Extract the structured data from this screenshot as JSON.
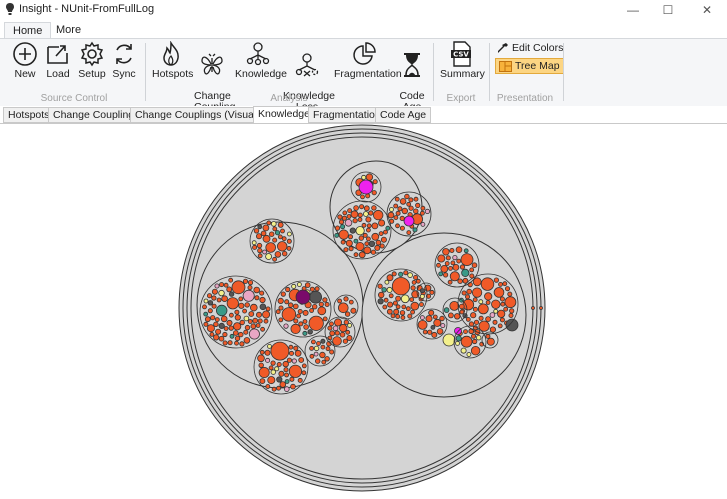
{
  "window": {
    "title": "Insight - NUnit-FromFullLog",
    "minimize": "—",
    "maximize": "☐",
    "close": "✕"
  },
  "ribbon_tabs": [
    "Home",
    "More"
  ],
  "ribbon": {
    "source_control": {
      "label": "Source Control",
      "buttons": [
        "New",
        "Load",
        "Setup",
        "Sync"
      ]
    },
    "analysis": {
      "label": "Analysis",
      "buttons": [
        "Hotspots",
        "Change\nCoupling",
        "Knowledge",
        "Knowledge\nLoss",
        "Fragmentation",
        "Code\nAge"
      ]
    },
    "export": {
      "label": "Export",
      "buttons": [
        "Summary"
      ]
    },
    "presentation": {
      "label": "Presentation",
      "edit_colors": "Edit Colors",
      "tree_map": "Tree Map"
    }
  },
  "doc_tabs": [
    "Hotspots",
    "Change Couplings",
    "Change Couplings (Visualize)",
    "Knowledge",
    "Fragmentation",
    "Code Age"
  ],
  "active_doc_tab": "Knowledge",
  "colors": {
    "orange": "#f05a28",
    "outline": "#333333",
    "container": "#d4d4d4",
    "magenta": "#ee22ee",
    "purple": "#7a0b6a",
    "teal": "#3a9a88",
    "yellow": "#f3f08c",
    "pink": "#e8a6c4",
    "darkgray": "#555555"
  }
}
